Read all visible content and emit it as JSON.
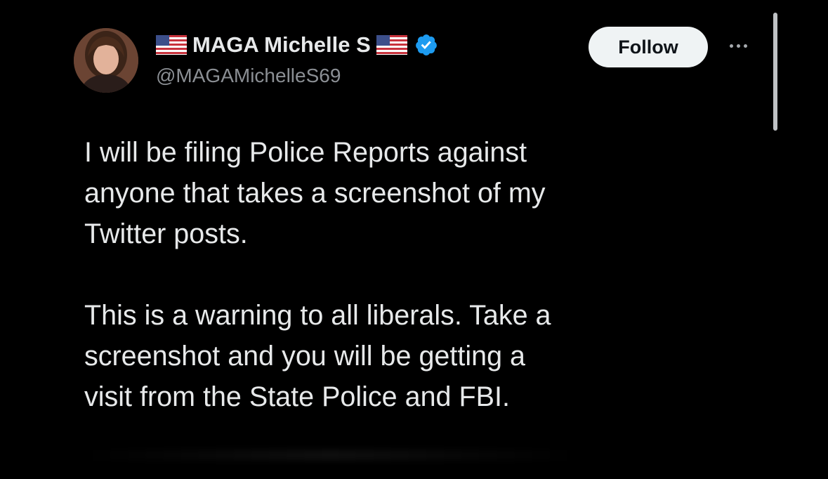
{
  "post": {
    "author": {
      "display_name": "MAGA Michelle S",
      "handle": "@MAGAMichelleS69",
      "verified": true,
      "name_emoji": "us-flag"
    },
    "follow_label": "Follow",
    "more_icon": "ellipsis-icon",
    "paragraphs": [
      "I will be filing Police Reports against\nanyone that takes a screenshot of my\nTwitter posts.",
      "This is a warning to all liberals. Take a\nscreenshot and you will be getting a\nvisit from the State Police and FBI."
    ]
  },
  "colors": {
    "background": "#000000",
    "text": "#e7e9ea",
    "secondary_text": "#8b8f94",
    "verified_badge": "#1d9bf0",
    "follow_button_bg": "#eff3f4"
  }
}
